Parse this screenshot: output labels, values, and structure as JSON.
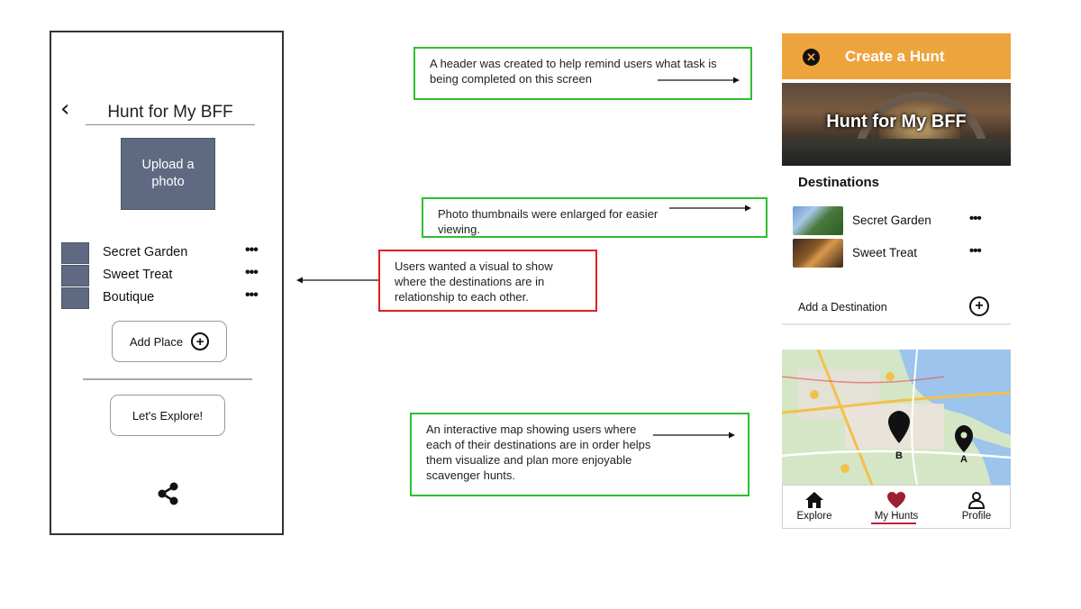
{
  "wireframe": {
    "back_glyph": "‹",
    "title": "Hunt for My BFF",
    "upload_label": "Upload a photo",
    "destinations": [
      {
        "label": "Secret Garden",
        "more": "•••"
      },
      {
        "label": "Sweet Treat",
        "more": "•••"
      },
      {
        "label": "Boutique",
        "more": "•••"
      }
    ],
    "add_place_label": "Add Place",
    "explore_label": "Let's Explore!",
    "icons": {
      "back": "chevron-left-icon",
      "plus": "plus-circle-icon",
      "share": "share-icon"
    }
  },
  "annotations": [
    {
      "text": "A header was created to help remind users what task is being completed on this screen",
      "color": "#2fbf2f"
    },
    {
      "text": "Photo thumbnails were enlarged for easier viewing.",
      "color": "#2fbf2f"
    },
    {
      "text": "Users wanted a visual to show where the destinations are in relationship to each other.",
      "color": "#e02020"
    },
    {
      "text": "An interactive map showing users where each of their destinations are in order helps them visualize and plan more enjoyable scavenger hunts.",
      "color": "#2fbf2f"
    }
  ],
  "mockup": {
    "header_title": "Create a Hunt",
    "hero_title": "Hunt for My BFF",
    "destinations_heading": "Destinations",
    "destinations": [
      {
        "label": "Secret Garden",
        "more": "•••"
      },
      {
        "label": "Sweet Treat",
        "more": "•••"
      }
    ],
    "add_destination_label": "Add a Destination",
    "map_markers": [
      "B",
      "A"
    ],
    "nav": [
      {
        "label": "Explore",
        "icon": "home-icon",
        "active": false
      },
      {
        "label": "My Hunts",
        "icon": "heart-icon",
        "active": true
      },
      {
        "label": "Profile",
        "icon": "user-icon",
        "active": false
      }
    ],
    "colors": {
      "header": "#eda43c",
      "active": "#b8243c"
    }
  }
}
